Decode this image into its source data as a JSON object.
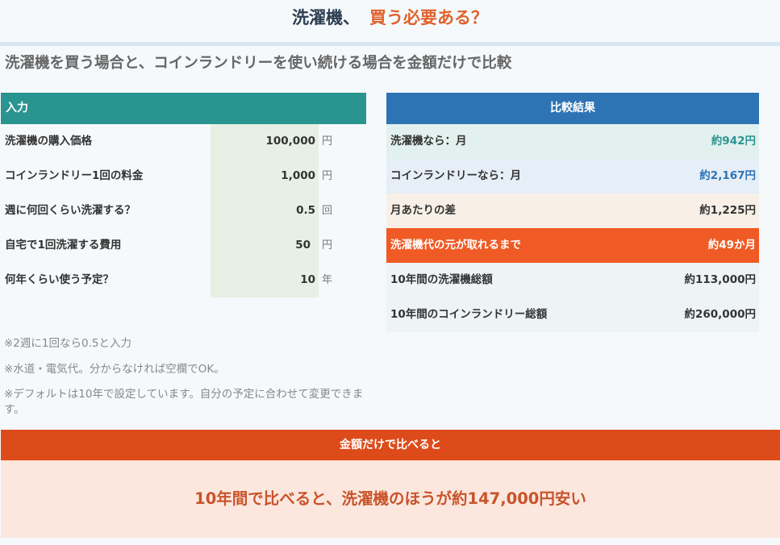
{
  "header": {
    "title_main": "洗濯機、",
    "title_accent": "買う必要ある？",
    "subtitle": "洗濯機を買う場合と、コインランドリーを使い続ける場合を金額だけで比較"
  },
  "input": {
    "heading": "入力",
    "rows": [
      {
        "label": "洗濯機の購入価格",
        "value": "100,000",
        "unit": "円"
      },
      {
        "label": "コインランドリー1回の料金",
        "value": "1,000",
        "unit": "円"
      },
      {
        "label": "週に何回くらい洗濯する？",
        "value": "0.5",
        "unit": "回"
      },
      {
        "label": "自宅で1回洗濯する費用",
        "value": "50",
        "unit": "円"
      },
      {
        "label": "何年くらい使う予定？",
        "value": "10",
        "unit": "年"
      }
    ],
    "notes": [
      "※2週に1回なら0.5と入力",
      "※水道・電気代。分からなければ空欄でOK。",
      "※デフォルトは10年で設定しています。自分の予定に合わせて変更できます。"
    ]
  },
  "result": {
    "heading": "比較結果",
    "rows": [
      {
        "label": "洗濯機なら：月",
        "value": "約942円"
      },
      {
        "label": "コインランドリーなら：月",
        "value": "約2,167円"
      },
      {
        "label": "月あたりの差",
        "value": "約1,225円"
      },
      {
        "label": "洗濯機代の元が取れるまで",
        "value": "約49か月"
      },
      {
        "label": "10年間の洗濯機総額",
        "value": "約113,000円"
      },
      {
        "label": "10年間のコインランドリー総額",
        "value": "約260,000円"
      }
    ]
  },
  "summary": {
    "heading": "金額だけで比べると",
    "message": "10年間で比べると、洗濯機のほうが約147,000円安い"
  },
  "colors": {
    "input_header": "#2a9490",
    "result_header": "#2e74b5",
    "highlight_row": "#f05a24",
    "summary_header": "#dd4b1a",
    "accent_text": "#e0622c"
  }
}
